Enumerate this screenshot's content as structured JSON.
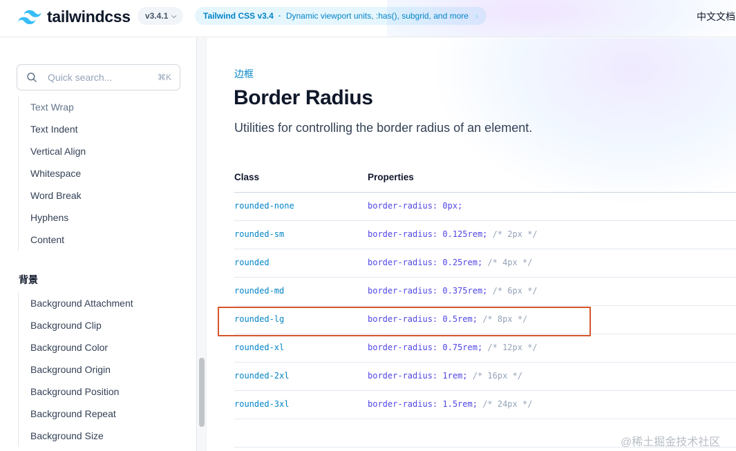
{
  "header": {
    "logo_text": "tailwindcss",
    "version": "v3.4.1",
    "announcement": {
      "strong": "Tailwind CSS v3.4",
      "separator": "·",
      "text": "Dynamic viewport units, :has(), subgrid, and more"
    },
    "language_label": "中文文档"
  },
  "sidebar": {
    "search": {
      "placeholder": "Quick search...",
      "shortcut": "⌘K"
    },
    "items_top": [
      {
        "label": "Text Wrap"
      },
      {
        "label": "Text Indent"
      },
      {
        "label": "Vertical Align"
      },
      {
        "label": "Whitespace"
      },
      {
        "label": "Word Break"
      },
      {
        "label": "Hyphens"
      },
      {
        "label": "Content"
      }
    ],
    "section_title": "背景",
    "items_bottom": [
      {
        "label": "Background Attachment"
      },
      {
        "label": "Background Clip"
      },
      {
        "label": "Background Color"
      },
      {
        "label": "Background Origin"
      },
      {
        "label": "Background Position"
      },
      {
        "label": "Background Repeat"
      },
      {
        "label": "Background Size"
      }
    ]
  },
  "main": {
    "eyebrow": "边框",
    "title": "Border Radius",
    "subtitle": "Utilities for controlling the border radius of an element.",
    "table": {
      "headers": [
        "Class",
        "Properties"
      ],
      "rows": [
        {
          "class": "rounded-none",
          "prop": "border-radius: 0px;",
          "comment": ""
        },
        {
          "class": "rounded-sm",
          "prop": "border-radius: 0.125rem;",
          "comment": "/* 2px */"
        },
        {
          "class": "rounded",
          "prop": "border-radius: 0.25rem;",
          "comment": "/* 4px */"
        },
        {
          "class": "rounded-md",
          "prop": "border-radius: 0.375rem;",
          "comment": "/* 6px */"
        },
        {
          "class": "rounded-lg",
          "prop": "border-radius: 0.5rem;",
          "comment": "/* 8px */"
        },
        {
          "class": "rounded-xl",
          "prop": "border-radius: 0.75rem;",
          "comment": "/* 12px */"
        },
        {
          "class": "rounded-2xl",
          "prop": "border-radius: 1rem;",
          "comment": "/* 16px */"
        },
        {
          "class": "rounded-3xl",
          "prop": "border-radius: 1.5rem;",
          "comment": "/* 24px */"
        }
      ],
      "highlighted_class": "rounded-lg"
    }
  },
  "watermark": "@稀土掘金技术社区",
  "colors": {
    "accent": "#0284c7",
    "property": "#4f46e5",
    "comment": "#94a3b8",
    "highlight_border": "#d5542a"
  },
  "icons": {
    "logo": "tailwind-wave-icon",
    "search": "search-icon",
    "version_chevron": "chevron-down-icon",
    "announce_chevron": "chevron-right-icon"
  }
}
